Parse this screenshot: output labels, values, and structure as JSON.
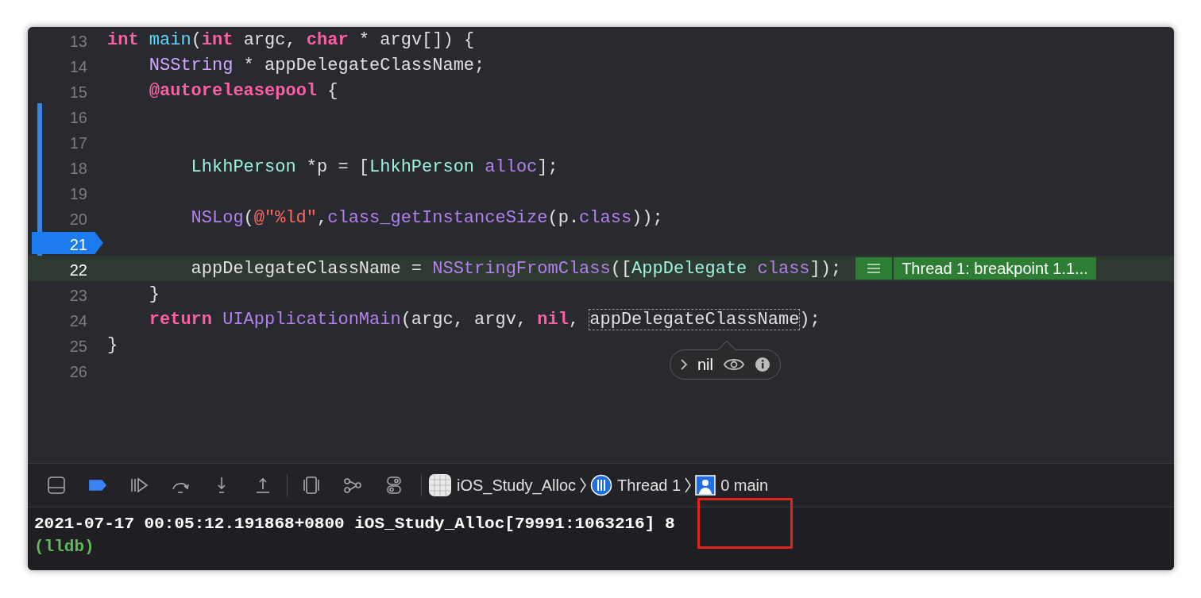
{
  "editor": {
    "lines": [
      {
        "number": "13",
        "changed": false,
        "breakpoint": false,
        "current": false,
        "tokens": [
          {
            "kind": "kw",
            "text": "int"
          },
          {
            "kind": "decl",
            "text": " main"
          },
          {
            "kind": "plain",
            "text": "("
          },
          {
            "kind": "kw",
            "text": "int"
          },
          {
            "kind": "plain",
            "text": " argc, "
          },
          {
            "kind": "kw",
            "text": "char"
          },
          {
            "kind": "plain",
            "text": " * argv[]) {"
          }
        ],
        "children": [
          {
            "number": "14",
            "changed": false,
            "breakpoint": false,
            "current": false,
            "tokens": [
              {
                "kind": "systype",
                "text": "NSString"
              },
              {
                "kind": "plain",
                "text": " * appDelegateClassName;"
              }
            ]
          },
          {
            "number": "15",
            "changed": false,
            "breakpoint": false,
            "current": false,
            "tokens": [
              {
                "kind": "kw",
                "text": "@autoreleasepool"
              },
              {
                "kind": "plain",
                "text": " {"
              }
            ],
            "children": [
              {
                "number": "16",
                "changed": true,
                "breakpoint": false,
                "current": false
              },
              {
                "number": "17",
                "changed": true,
                "breakpoint": false,
                "current": false
              },
              {
                "number": "18",
                "changed": true,
                "breakpoint": false,
                "current": false,
                "tokens": [
                  {
                    "kind": "projtype",
                    "text": "LhkhPerson"
                  },
                  {
                    "kind": "plain",
                    "text": " *p = ["
                  },
                  {
                    "kind": "projtype",
                    "text": "LhkhPerson"
                  },
                  {
                    "kind": "sysfunc",
                    "text": " alloc"
                  },
                  {
                    "kind": "plain",
                    "text": "];"
                  }
                ]
              },
              {
                "number": "19",
                "changed": true,
                "breakpoint": false,
                "current": false
              },
              {
                "number": "20",
                "changed": true,
                "breakpoint": false,
                "current": false,
                "tokens": [
                  {
                    "kind": "sysfunc",
                    "text": "NSLog"
                  },
                  {
                    "kind": "plain",
                    "text": "("
                  },
                  {
                    "kind": "string",
                    "text": "@\"%ld\""
                  },
                  {
                    "kind": "plain",
                    "text": ","
                  },
                  {
                    "kind": "sysfunc",
                    "text": "class_getInstanceSize"
                  },
                  {
                    "kind": "plain",
                    "text": "(p."
                  },
                  {
                    "kind": "sysfunc",
                    "text": "class"
                  },
                  {
                    "kind": "plain",
                    "text": "));"
                  }
                ]
              },
              {
                "number": "21",
                "changed": true,
                "breakpoint": true,
                "current": false
              },
              {
                "number": "22",
                "changed": false,
                "breakpoint": false,
                "current": true,
                "badge": "Thread 1: breakpoint 1.1...",
                "tokens": [
                  {
                    "kind": "plain",
                    "text": "appDelegateClassName = "
                  },
                  {
                    "kind": "sysfunc",
                    "text": "NSStringFromClass"
                  },
                  {
                    "kind": "plain",
                    "text": "(["
                  },
                  {
                    "kind": "projtype",
                    "text": "AppDelegate"
                  },
                  {
                    "kind": "sysfunc",
                    "text": " class"
                  },
                  {
                    "kind": "plain",
                    "text": "]);"
                  }
                ]
              }
            ]
          },
          {
            "number": "23",
            "changed": false,
            "breakpoint": false,
            "current": false,
            "tokens": [
              {
                "kind": "plain",
                "text": "}"
              }
            ]
          },
          {
            "number": "24",
            "changed": false,
            "breakpoint": false,
            "current": false,
            "tokens": [
              {
                "kind": "kw",
                "text": "return"
              },
              {
                "kind": "sysfunc",
                "text": " UIApplicationMain"
              },
              {
                "kind": "plain",
                "text": "(argc, argv, "
              },
              {
                "kind": "kw",
                "text": "nil"
              },
              {
                "kind": "plain",
                "text": ", "
              },
              {
                "kind": "hover",
                "text": "appDelegateClassName"
              },
              {
                "kind": "plain",
                "text": ");"
              }
            ]
          }
        ]
      },
      {
        "number": "25",
        "changed": false,
        "breakpoint": false,
        "current": false,
        "tokens": [
          {
            "kind": "plain",
            "text": "}"
          }
        ]
      },
      {
        "number": "26",
        "changed": false,
        "breakpoint": false,
        "current": false
      }
    ],
    "popover": {
      "value": "nil"
    }
  },
  "debug_bar": {
    "buttons": [
      {
        "kind": "hide",
        "on": false
      },
      {
        "kind": "breakpoints",
        "on": true
      },
      {
        "kind": "continue",
        "on": false
      },
      {
        "kind": "stepover",
        "on": false
      },
      {
        "kind": "stepinto",
        "on": false
      },
      {
        "kind": "stepout",
        "on": false
      },
      {
        "kind": "viewdebug",
        "on": false
      },
      {
        "kind": "memory",
        "on": false
      },
      {
        "kind": "env",
        "on": false
      }
    ],
    "breadcrumbs": [
      {
        "kind": "app",
        "label": "iOS_Study_Alloc"
      },
      {
        "kind": "thread",
        "label": "Thread 1"
      },
      {
        "kind": "frame",
        "label": "0 main"
      }
    ]
  },
  "console": {
    "lines": [
      {
        "kind": "output",
        "text": "2021-07-17 00:05:12.191868+0800 iOS_Study_Alloc[79991:1063216] 8"
      },
      {
        "kind": "prompt",
        "text": "(lldb)"
      }
    ]
  }
}
